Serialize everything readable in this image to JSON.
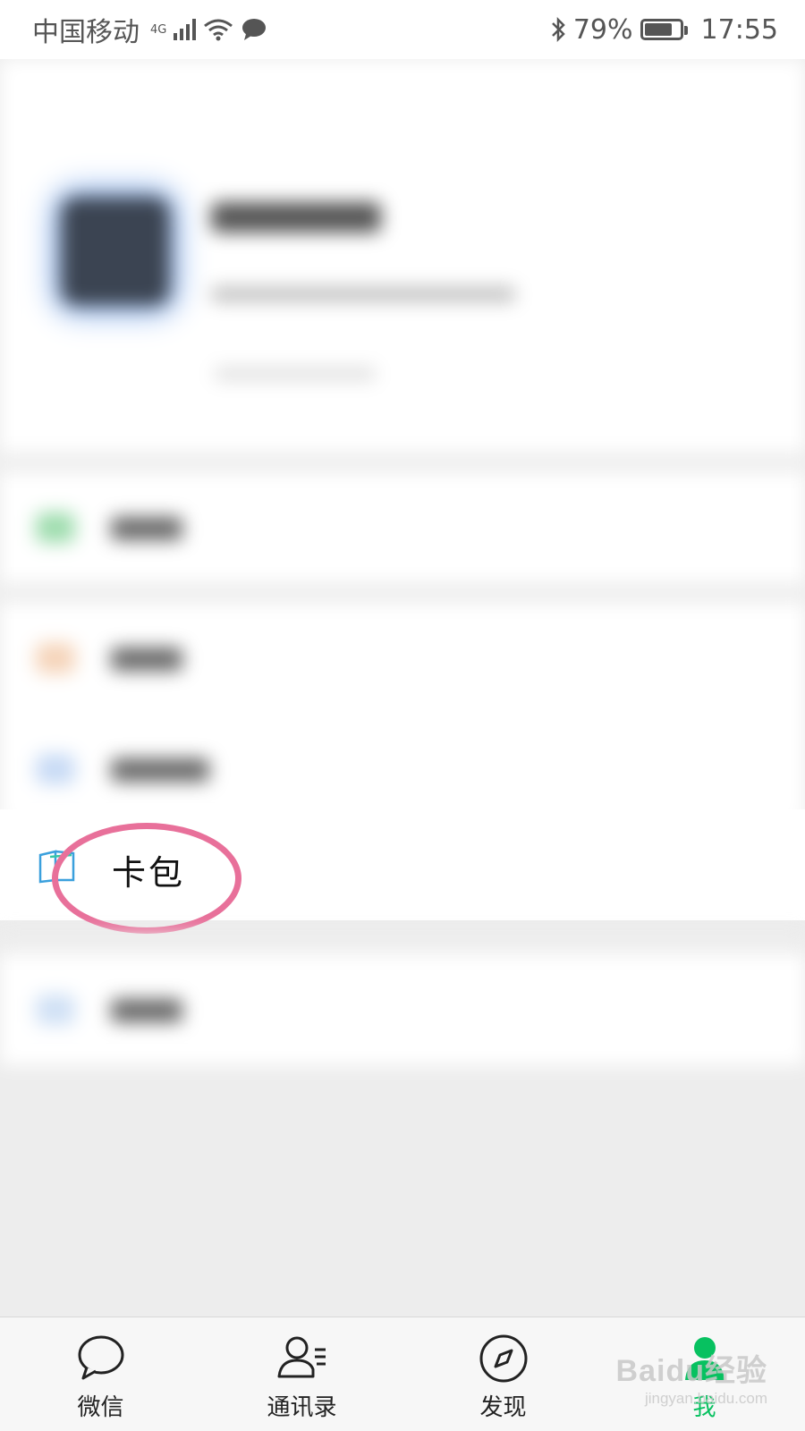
{
  "status_bar": {
    "carrier": "中国移动",
    "network_type": "4G",
    "battery_percent": "79%",
    "battery_level": 0.79,
    "time": "17:55"
  },
  "menu": {
    "wallet_label": "卡包"
  },
  "tab_bar": {
    "tabs": [
      {
        "label": "微信",
        "icon": "chat-bubble-icon"
      },
      {
        "label": "通讯录",
        "icon": "contacts-icon"
      },
      {
        "label": "发现",
        "icon": "compass-icon"
      },
      {
        "label": "我",
        "icon": "person-icon",
        "active": true
      }
    ]
  },
  "colors": {
    "accent_green": "#07c160",
    "highlight_pink": "#e8709a"
  },
  "watermark": {
    "brand": "Baidu经验",
    "url": "jingyan.baidu.com"
  }
}
